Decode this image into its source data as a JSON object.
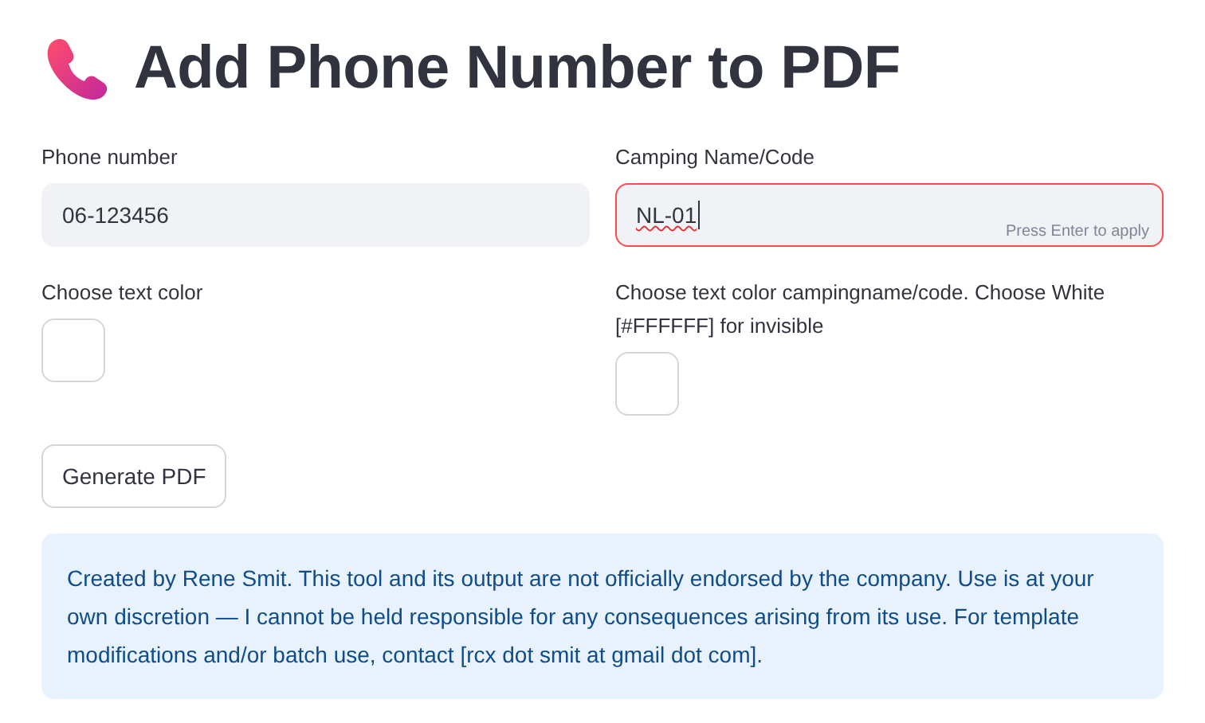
{
  "title": "Add Phone Number to PDF",
  "fields": [
    {
      "kind": "text",
      "label": "Phone number",
      "value": "06-123456",
      "focused": false,
      "misspelled": false
    },
    {
      "kind": "text",
      "label": "Camping Name/Code",
      "value": "NL-01",
      "focused": true,
      "misspelled": true,
      "hint": "Press Enter to apply"
    },
    {
      "kind": "color",
      "label": "Choose text color",
      "color": "#ffffff"
    },
    {
      "kind": "color",
      "label": "Choose text color campingname/code. Choose White [#FFFFFF] for invisible",
      "color": "#ffffff"
    }
  ],
  "button": "Generate PDF",
  "info": "Created by Rene Smit. This tool and its output are not officially endorsed by the company. Use is at your own discretion — I cannot be held responsible for any consequences arising from its use. For template modifications and/or batch use, contact [rcx dot smit at gmail dot com]."
}
